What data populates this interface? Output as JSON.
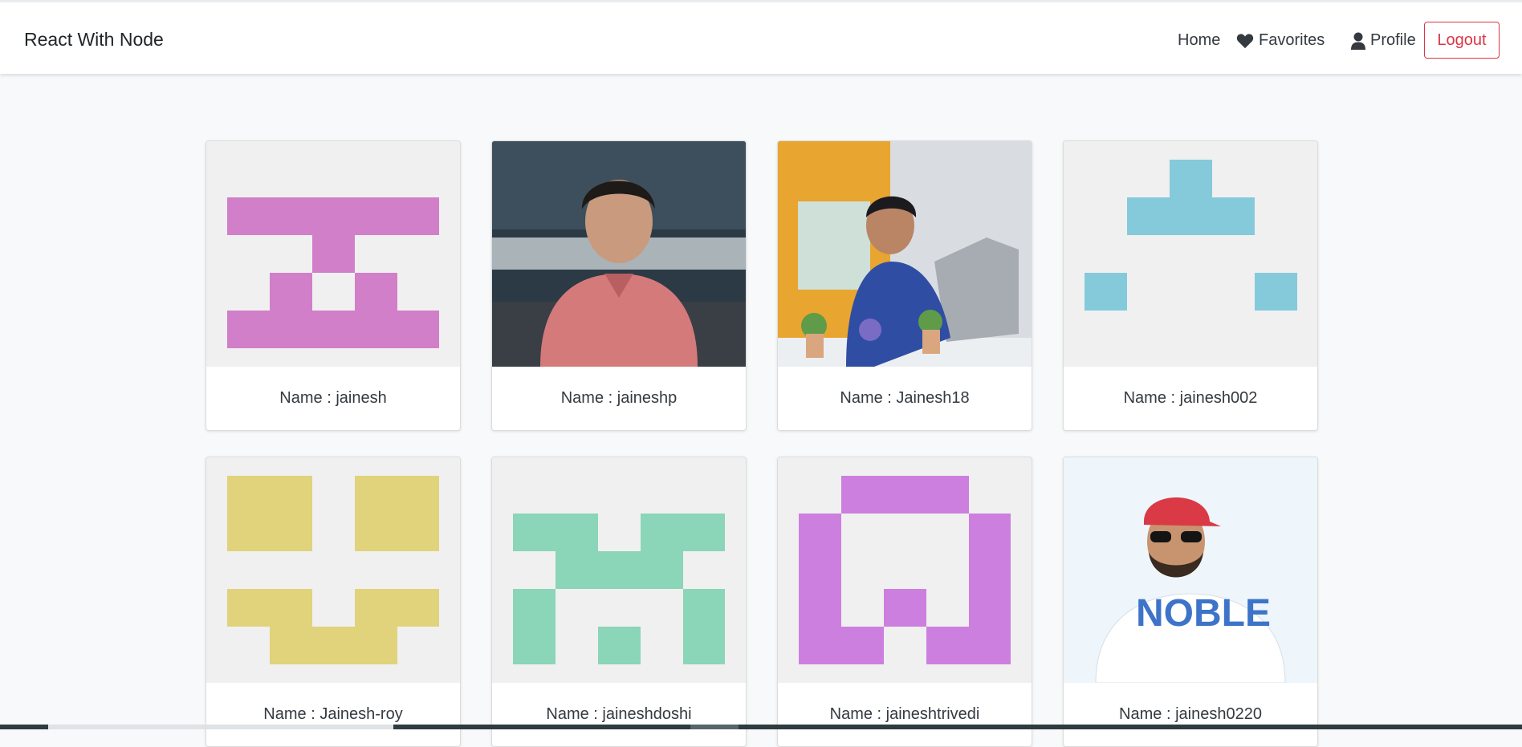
{
  "navbar": {
    "brand": "React With Node",
    "home": "Home",
    "favorites": "Favorites",
    "profile": "Profile",
    "logout": "Logout"
  },
  "colors": {
    "danger": "#dc3545",
    "identicon_pink": "#d17fc9",
    "identicon_blue": "#85cada",
    "identicon_yellow": "#e0d37b",
    "identicon_green": "#8bd5b8",
    "identicon_purple": "#cc7fdf"
  },
  "users": [
    {
      "label": "Name : jainesh",
      "avatar": "identicon-pink"
    },
    {
      "label": "Name : jaineshp",
      "avatar": "photo-portrait-pink-shirt"
    },
    {
      "label": "Name : Jainesh18",
      "avatar": "photo-man-with-laptop"
    },
    {
      "label": "Name : jainesh002",
      "avatar": "identicon-blue"
    },
    {
      "label": "Name : Jainesh-roy",
      "avatar": "identicon-yellow"
    },
    {
      "label": "Name : jaineshdoshi",
      "avatar": "identicon-green"
    },
    {
      "label": "Name : jaineshtrivedi",
      "avatar": "identicon-purple"
    },
    {
      "label": "Name : jainesh0220",
      "avatar": "photo-man-red-cap"
    }
  ]
}
